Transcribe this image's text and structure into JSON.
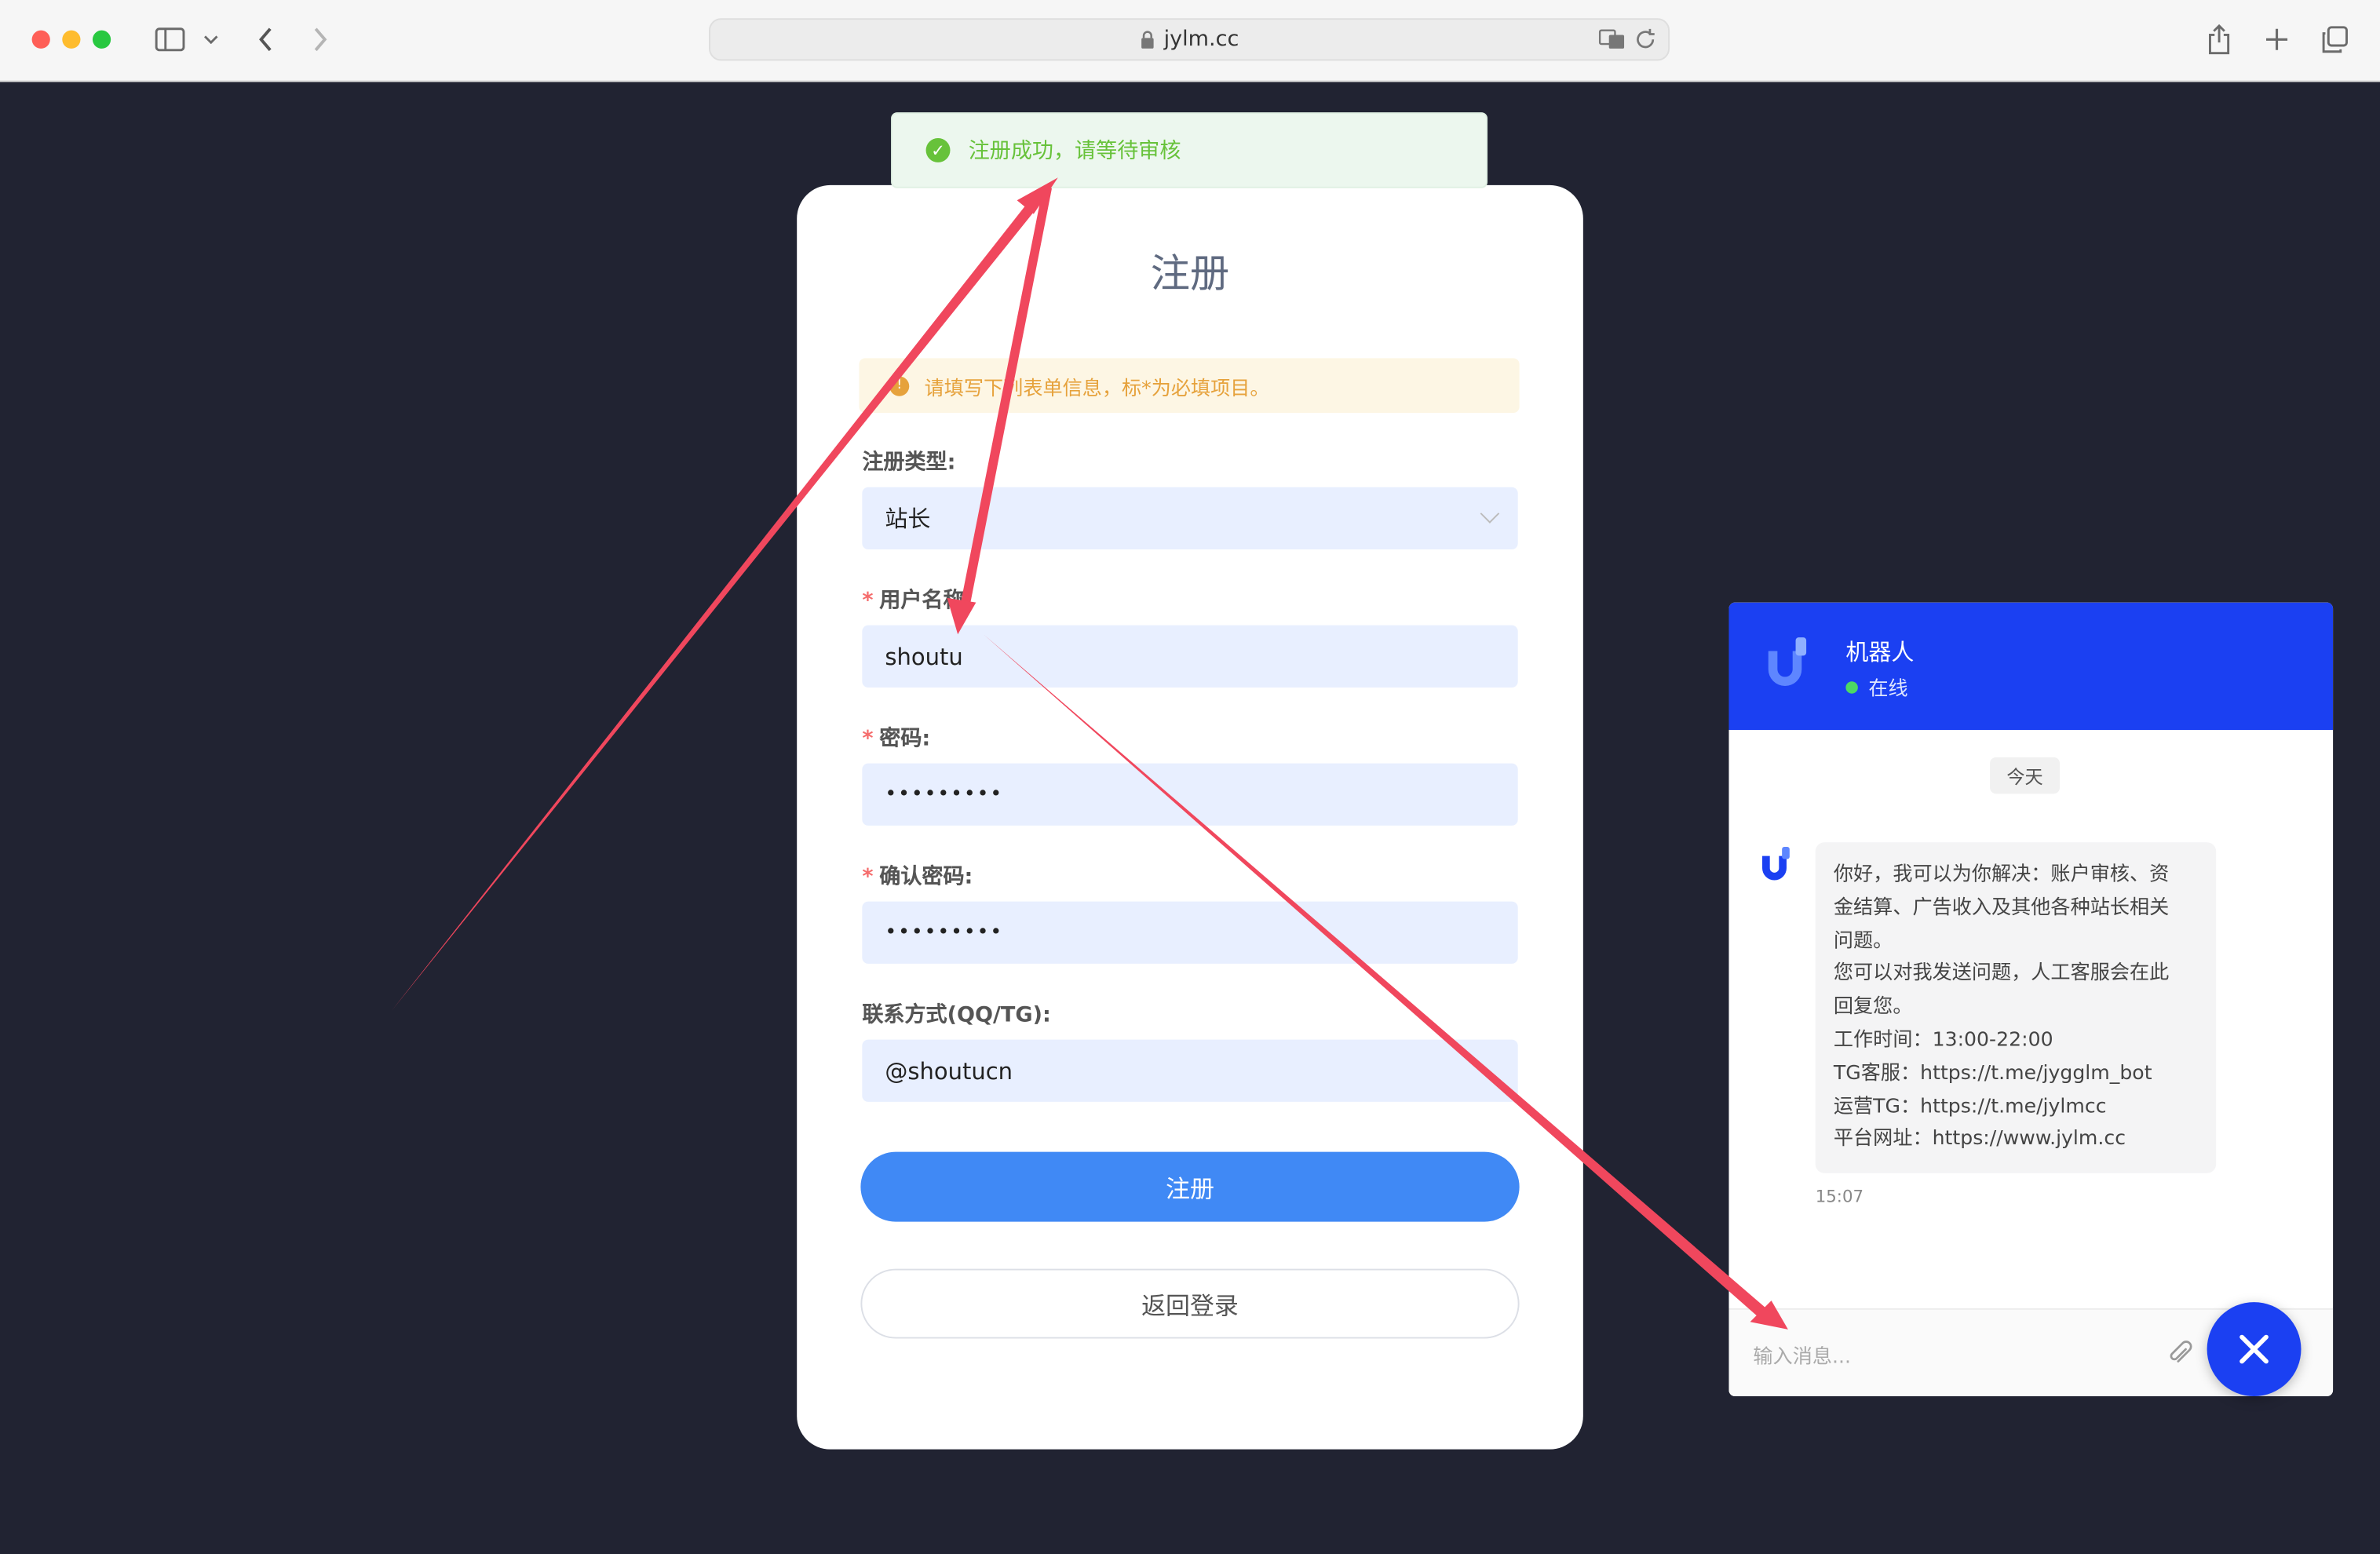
{
  "browser": {
    "url": "jylm.cc"
  },
  "toast": {
    "message": "注册成功，请等待审核"
  },
  "form": {
    "title": "注册",
    "notice": "请填写下列表单信息，标*为必填项目。",
    "type_label": "注册类型:",
    "type_value": "站长",
    "username_label": "用户名称:",
    "username_value": "shoutu",
    "password_label": "密码:",
    "password_value": "•••••••••",
    "confirm_label": "确认密码:",
    "confirm_value": "•••••••••",
    "contact_label": "联系方式(QQ/TG):",
    "contact_value": "@shoutucn",
    "submit_label": "注册",
    "back_label": "返回登录"
  },
  "chat": {
    "bot_name": "机器人",
    "status": "在线",
    "date": "今天",
    "message_lines": [
      "你好，我可以为你解决：账户审核、资",
      "金结算、广告收入及其他各种站长相关",
      "问题。",
      "您可以对我发送问题，人工客服会在此",
      "回复您。",
      "工作时间：13:00-22:00",
      "TG客服：https://t.me/jygglm_bot",
      "运营TG：https://t.me/jylmcc",
      "平台网址：https://www.jylm.cc"
    ],
    "time": "15:07",
    "input_placeholder": "输入消息..."
  },
  "colors": {
    "page_bg": "#212332",
    "accent": "#4089f5",
    "chat_header": "#1b40f2",
    "success": "#67c23a",
    "annotation": "#f0475d"
  }
}
